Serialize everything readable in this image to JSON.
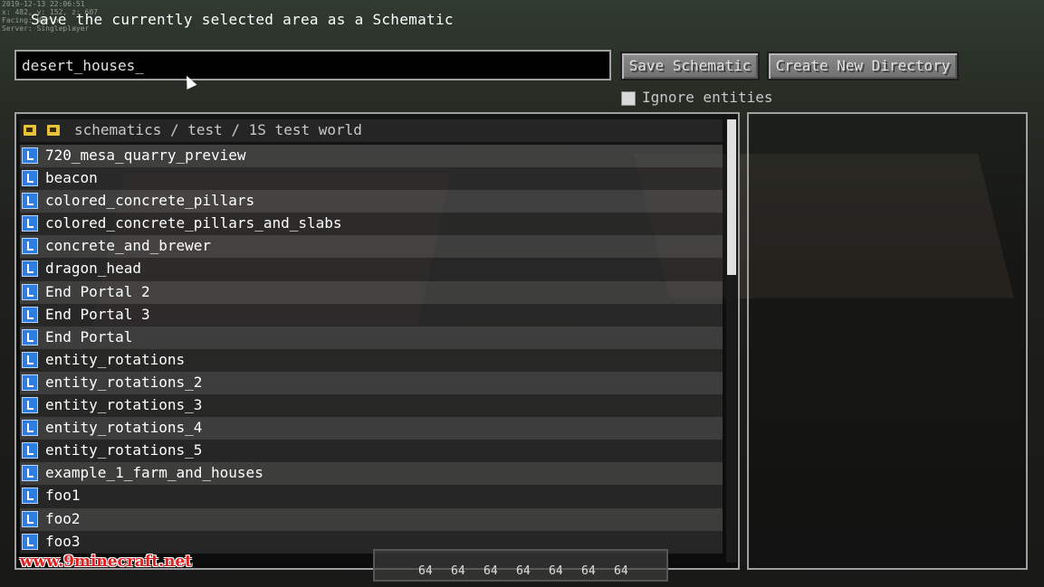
{
  "debug_overlay": {
    "lines": [
      "2019-12-13 22:06:51",
      "x: 482, y: 152, z: 607",
      "Facing: North",
      "Server: Singleplayer"
    ]
  },
  "title": "Save the currently selected area as a Schematic",
  "name_input": {
    "value": "desert_houses_"
  },
  "buttons": {
    "save_schematic": "Save Schematic",
    "create_new_directory": "Create New Directory"
  },
  "ignore_entities": {
    "label": "Ignore entities",
    "checked": false
  },
  "browser": {
    "path": "schematics / test / 1S test world",
    "files": [
      "720_mesa_quarry_preview",
      "beacon",
      "colored_concrete_pillars",
      "colored_concrete_pillars_and_slabs",
      "concrete_and_brewer",
      "dragon_head",
      "End Portal 2",
      "End Portal 3",
      "End Portal",
      "entity_rotations",
      "entity_rotations_2",
      "entity_rotations_3",
      "entity_rotations_4",
      "entity_rotations_5",
      "example_1_farm_and_houses",
      "foo1",
      "foo2",
      "foo3"
    ]
  },
  "hotbar": {
    "counts": [
      "64",
      "64",
      "64",
      "64",
      "64",
      "64",
      "64"
    ]
  },
  "watermark": "www.9minecraft.net",
  "colors": {
    "accent_folder": "#e8c33a",
    "file_icon": "#2f7de0",
    "watermark": "#e02020"
  }
}
